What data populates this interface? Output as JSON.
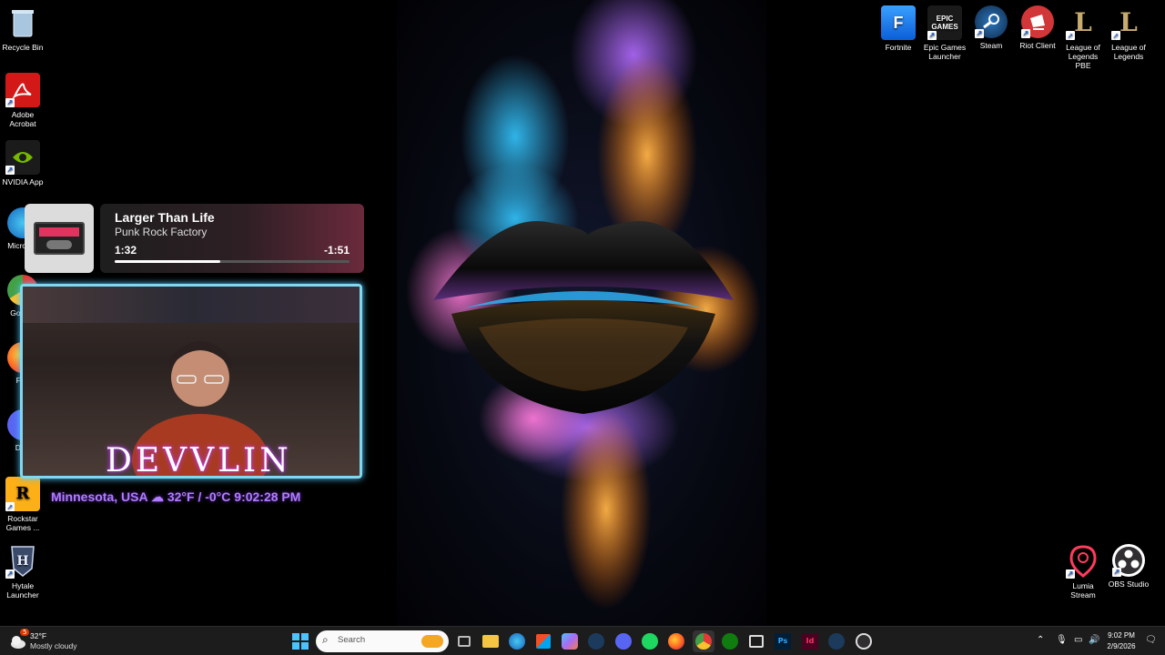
{
  "desktop": {
    "left_icons": [
      {
        "label": "Recycle Bin",
        "icon": "recycle-bin-icon"
      },
      {
        "label": "Adobe Acrobat",
        "icon": "adobe-acrobat-icon"
      },
      {
        "label": "NVIDIA App",
        "icon": "nvidia-icon"
      },
      {
        "label": "Micro Ed",
        "icon": "edge-icon"
      },
      {
        "label": "Go Chr",
        "icon": "chrome-icon"
      },
      {
        "label": "Fire",
        "icon": "firefox-icon"
      },
      {
        "label": "Disc",
        "icon": "discord-icon"
      },
      {
        "label": "Rockstar Games ...",
        "icon": "rockstar-icon"
      },
      {
        "label": "Hytale Launcher",
        "icon": "hytale-icon"
      }
    ],
    "right_icons": [
      {
        "label": "Fortnite",
        "icon": "fortnite-icon"
      },
      {
        "label": "Epic Games Launcher",
        "icon": "epic-games-icon",
        "text": "EPIC GAMES"
      },
      {
        "label": "Steam",
        "icon": "steam-icon"
      },
      {
        "label": "Riot Client",
        "icon": "riot-client-icon"
      },
      {
        "label": "League of Legends PBE",
        "icon": "league-pbe-icon"
      },
      {
        "label": "League of Legends",
        "icon": "league-icon"
      }
    ],
    "bottom_right_icons": [
      {
        "label": "Lumia Stream",
        "icon": "lumia-stream-icon"
      },
      {
        "label": "OBS Studio",
        "icon": "obs-studio-icon"
      }
    ]
  },
  "media": {
    "title": "Larger Than Life",
    "artist": "Punk Rock Factory",
    "elapsed": "1:32",
    "remaining": "-1:51",
    "progress": 0.45
  },
  "stream_overlay": {
    "name": "DEVVLIN",
    "location": "Minnesota, USA",
    "temperature": "32°F / -0°C",
    "time": "9:02:28 PM"
  },
  "taskbar": {
    "weather_temp": "32°F",
    "weather_cond": "Mostly cloudy",
    "weather_badge": "5",
    "search_placeholder": "Search",
    "pinned": [
      "start-icon",
      "task-view-icon",
      "file-explorer-icon",
      "edge-icon",
      "store-icon",
      "copilot-icon",
      "steam-icon",
      "discord-icon",
      "spotify-icon",
      "firefox-icon",
      "chrome-icon",
      "xbox-icon",
      "screen-capture-icon",
      "photoshop-icon",
      "indesign-icon",
      "steam-icon",
      "obs-icon"
    ],
    "clock_time": "9:02 PM",
    "clock_date": "2/9/2026"
  },
  "colors": {
    "accent_overlay": "#b07cff",
    "webcam_border": "#7fd8f0",
    "taskbar": "#1c1c1c"
  }
}
